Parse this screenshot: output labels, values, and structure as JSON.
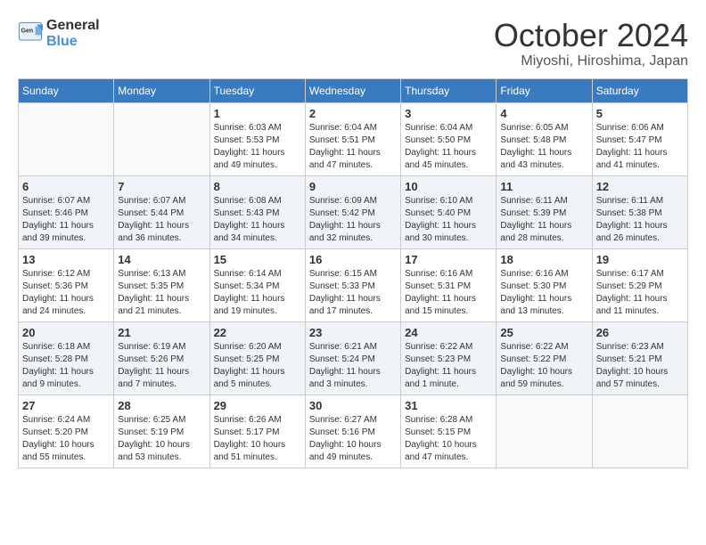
{
  "logo": {
    "general": "General",
    "blue": "Blue"
  },
  "title": "October 2024",
  "location": "Miyoshi, Hiroshima, Japan",
  "weekdays": [
    "Sunday",
    "Monday",
    "Tuesday",
    "Wednesday",
    "Thursday",
    "Friday",
    "Saturday"
  ],
  "weeks": [
    [
      {
        "day": "",
        "info": ""
      },
      {
        "day": "",
        "info": ""
      },
      {
        "day": "1",
        "info": "Sunrise: 6:03 AM\nSunset: 5:53 PM\nDaylight: 11 hours and 49 minutes."
      },
      {
        "day": "2",
        "info": "Sunrise: 6:04 AM\nSunset: 5:51 PM\nDaylight: 11 hours and 47 minutes."
      },
      {
        "day": "3",
        "info": "Sunrise: 6:04 AM\nSunset: 5:50 PM\nDaylight: 11 hours and 45 minutes."
      },
      {
        "day": "4",
        "info": "Sunrise: 6:05 AM\nSunset: 5:48 PM\nDaylight: 11 hours and 43 minutes."
      },
      {
        "day": "5",
        "info": "Sunrise: 6:06 AM\nSunset: 5:47 PM\nDaylight: 11 hours and 41 minutes."
      }
    ],
    [
      {
        "day": "6",
        "info": "Sunrise: 6:07 AM\nSunset: 5:46 PM\nDaylight: 11 hours and 39 minutes."
      },
      {
        "day": "7",
        "info": "Sunrise: 6:07 AM\nSunset: 5:44 PM\nDaylight: 11 hours and 36 minutes."
      },
      {
        "day": "8",
        "info": "Sunrise: 6:08 AM\nSunset: 5:43 PM\nDaylight: 11 hours and 34 minutes."
      },
      {
        "day": "9",
        "info": "Sunrise: 6:09 AM\nSunset: 5:42 PM\nDaylight: 11 hours and 32 minutes."
      },
      {
        "day": "10",
        "info": "Sunrise: 6:10 AM\nSunset: 5:40 PM\nDaylight: 11 hours and 30 minutes."
      },
      {
        "day": "11",
        "info": "Sunrise: 6:11 AM\nSunset: 5:39 PM\nDaylight: 11 hours and 28 minutes."
      },
      {
        "day": "12",
        "info": "Sunrise: 6:11 AM\nSunset: 5:38 PM\nDaylight: 11 hours and 26 minutes."
      }
    ],
    [
      {
        "day": "13",
        "info": "Sunrise: 6:12 AM\nSunset: 5:36 PM\nDaylight: 11 hours and 24 minutes."
      },
      {
        "day": "14",
        "info": "Sunrise: 6:13 AM\nSunset: 5:35 PM\nDaylight: 11 hours and 21 minutes."
      },
      {
        "day": "15",
        "info": "Sunrise: 6:14 AM\nSunset: 5:34 PM\nDaylight: 11 hours and 19 minutes."
      },
      {
        "day": "16",
        "info": "Sunrise: 6:15 AM\nSunset: 5:33 PM\nDaylight: 11 hours and 17 minutes."
      },
      {
        "day": "17",
        "info": "Sunrise: 6:16 AM\nSunset: 5:31 PM\nDaylight: 11 hours and 15 minutes."
      },
      {
        "day": "18",
        "info": "Sunrise: 6:16 AM\nSunset: 5:30 PM\nDaylight: 11 hours and 13 minutes."
      },
      {
        "day": "19",
        "info": "Sunrise: 6:17 AM\nSunset: 5:29 PM\nDaylight: 11 hours and 11 minutes."
      }
    ],
    [
      {
        "day": "20",
        "info": "Sunrise: 6:18 AM\nSunset: 5:28 PM\nDaylight: 11 hours and 9 minutes."
      },
      {
        "day": "21",
        "info": "Sunrise: 6:19 AM\nSunset: 5:26 PM\nDaylight: 11 hours and 7 minutes."
      },
      {
        "day": "22",
        "info": "Sunrise: 6:20 AM\nSunset: 5:25 PM\nDaylight: 11 hours and 5 minutes."
      },
      {
        "day": "23",
        "info": "Sunrise: 6:21 AM\nSunset: 5:24 PM\nDaylight: 11 hours and 3 minutes."
      },
      {
        "day": "24",
        "info": "Sunrise: 6:22 AM\nSunset: 5:23 PM\nDaylight: 11 hours and 1 minute."
      },
      {
        "day": "25",
        "info": "Sunrise: 6:22 AM\nSunset: 5:22 PM\nDaylight: 10 hours and 59 minutes."
      },
      {
        "day": "26",
        "info": "Sunrise: 6:23 AM\nSunset: 5:21 PM\nDaylight: 10 hours and 57 minutes."
      }
    ],
    [
      {
        "day": "27",
        "info": "Sunrise: 6:24 AM\nSunset: 5:20 PM\nDaylight: 10 hours and 55 minutes."
      },
      {
        "day": "28",
        "info": "Sunrise: 6:25 AM\nSunset: 5:19 PM\nDaylight: 10 hours and 53 minutes."
      },
      {
        "day": "29",
        "info": "Sunrise: 6:26 AM\nSunset: 5:17 PM\nDaylight: 10 hours and 51 minutes."
      },
      {
        "day": "30",
        "info": "Sunrise: 6:27 AM\nSunset: 5:16 PM\nDaylight: 10 hours and 49 minutes."
      },
      {
        "day": "31",
        "info": "Sunrise: 6:28 AM\nSunset: 5:15 PM\nDaylight: 10 hours and 47 minutes."
      },
      {
        "day": "",
        "info": ""
      },
      {
        "day": "",
        "info": ""
      }
    ]
  ]
}
